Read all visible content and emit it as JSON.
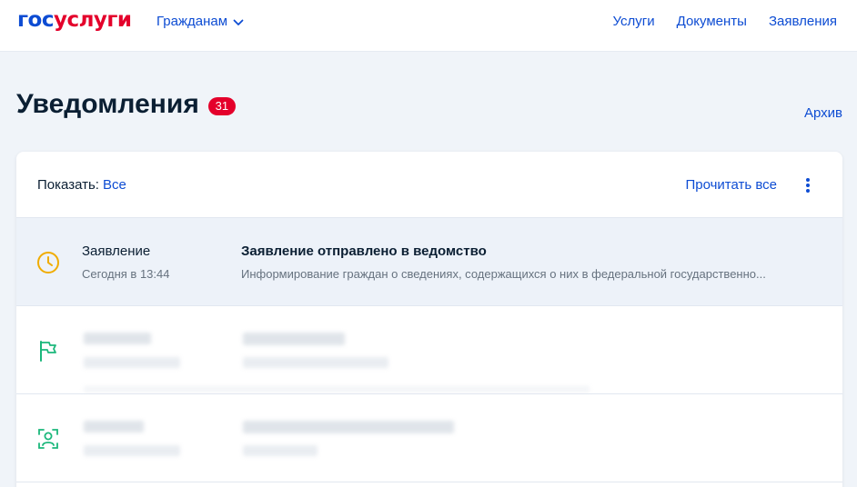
{
  "header": {
    "logo_part1": "гос",
    "logo_part2": "услуги",
    "audience_label": "Гражданам",
    "nav": [
      "Услуги",
      "Документы",
      "Заявления"
    ]
  },
  "page": {
    "title": "Уведомления",
    "unread_count": "31",
    "archive_label": "Архив"
  },
  "toolbar": {
    "filter_label": "Показать:",
    "filter_value": "Все",
    "read_all_label": "Прочитать все",
    "more_icon": "kebab-vertical-icon"
  },
  "notifications": [
    {
      "category": "Заявление",
      "time": "Сегодня в 13:44",
      "title": "Заявление отправлено в ведомство",
      "description": "Информирование граждан о сведениях, содержащихся о них в федеральной государственно...",
      "icon": "clock-icon",
      "icon_color": "#f0ac00",
      "unread": true
    },
    {
      "icon": "flag-icon",
      "icon_color": "#1bb77b",
      "redacted": true
    },
    {
      "icon": "user-id-icon",
      "icon_color": "#1bb77b",
      "redacted": true
    }
  ],
  "colors": {
    "link": "#0d4cd3",
    "brand_red": "#e4002b",
    "page_bg": "#f0f4f9",
    "unread_row_bg": "#edf2f9"
  }
}
